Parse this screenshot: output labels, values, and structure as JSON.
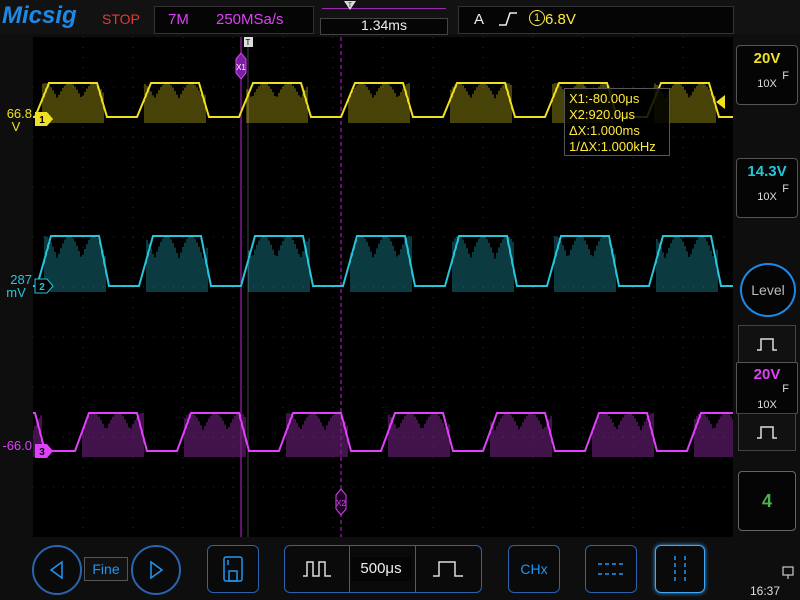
{
  "brand": "Micsig",
  "status": "STOP",
  "memory_depth": "7M",
  "sample_rate": "250MSa/s",
  "trigger_time_position": "1.34ms",
  "trigger": {
    "source": "A",
    "slope_icon": "rising-edge-icon",
    "channel": "1",
    "level": "6.8V"
  },
  "cursor_readout": {
    "x1": "X1:-80.00μs",
    "x2": "X2:920.0μs",
    "dx": "ΔX:1.000ms",
    "inv_dx": "1/ΔX:1.000kHz"
  },
  "cursor_labels": {
    "x1": "X1",
    "x2": "X2",
    "trigger_marker": "T"
  },
  "channels": [
    {
      "id": "1",
      "offset_label": "66.8",
      "offset_unit": "V",
      "color": "#f0e020",
      "scale": "20V",
      "coupling": "F",
      "probe": "10X"
    },
    {
      "id": "2",
      "offset_label": "287",
      "offset_unit": "mV",
      "color": "#26c6da",
      "scale": "14.3V",
      "coupling": "F",
      "probe": "10X"
    },
    {
      "id": "3",
      "offset_label": "-66.0",
      "offset_unit": "V",
      "color": "#e040fb",
      "scale": "20V",
      "coupling": "F",
      "probe": "10X"
    }
  ],
  "right_panel": {
    "level_button": "Level",
    "math_channel": "4"
  },
  "bottom_bar": {
    "fine_label": "Fine",
    "timebase": "500μs",
    "chx_label": "CHx"
  },
  "clock": "16:37",
  "colors": {
    "accent_blue": "#1e88e5",
    "stop_red": "#e53935",
    "ch1": "#f0e020",
    "ch2": "#26c6da",
    "ch3": "#e040fb"
  }
}
